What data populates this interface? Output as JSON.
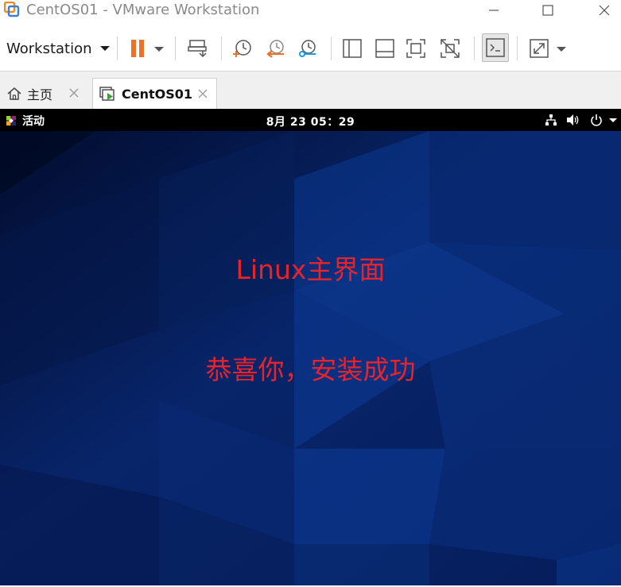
{
  "window": {
    "title": "CentOS01 - VMware Workstation"
  },
  "toolbar": {
    "workstation_menu": "Workstation"
  },
  "tabs": [
    {
      "label": "主页",
      "icon": "home-icon"
    },
    {
      "label": "CentOS01",
      "icon": "vm-running-icon"
    }
  ],
  "vm": {
    "topbar": {
      "activities": "活动",
      "clock": "8月 23  05：29"
    },
    "overlay": {
      "line1": "Linux主界面",
      "line2": "恭喜你，安装成功"
    }
  },
  "colors": {
    "accent_orange": "#e8732b",
    "overlay_text": "#e8232b",
    "desktop_blue": "#0a2a6e",
    "tray_bar": "#000000"
  }
}
